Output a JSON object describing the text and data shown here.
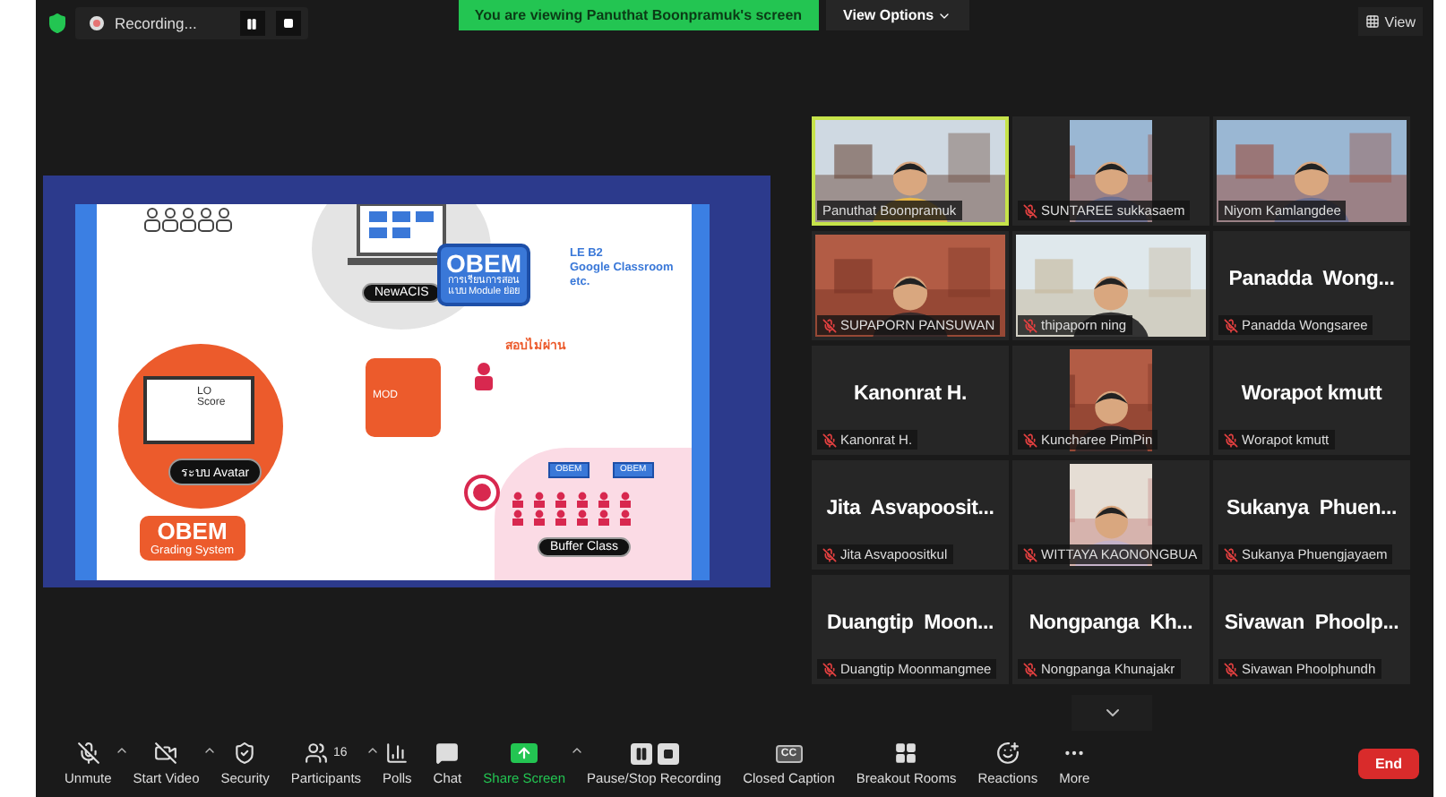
{
  "top_bar": {
    "recording": {
      "label": "Recording..."
    },
    "banner": "You are viewing Panuthat Boonpramuk's screen",
    "view_options": "View Options",
    "view_button": "View"
  },
  "shared_slide": {
    "top_system": "NewACIS",
    "obem": {
      "title": "OBEM",
      "lines": [
        "การเรียนการสอน",
        "แบบ Module ย่อย"
      ]
    },
    "links": [
      "LE B2",
      "Google Classroom",
      "etc."
    ],
    "lo_score": [
      "LO",
      "Score"
    ],
    "avatar": "ระบบ Avatar",
    "grading": {
      "title": "OBEM",
      "subtitle": "Grading System"
    },
    "mod": "MOD",
    "fail_heading": "สอบไม่ผ่าน",
    "buffer": "Buffer Class",
    "buffer_boxes": [
      "OBEM",
      "OBEM"
    ]
  },
  "tiles": [
    {
      "kind": "video",
      "name": "Panuthat Boonpramuk",
      "muted": false,
      "active": true
    },
    {
      "kind": "profile_photo",
      "name": "SUNTAREE sukkasaem",
      "muted": true,
      "active": false
    },
    {
      "kind": "video",
      "name": "Niyom Kamlangdee",
      "muted": false,
      "active": false
    },
    {
      "kind": "video",
      "name": "SUPAPORN PANSUWAN",
      "muted": true,
      "active": false
    },
    {
      "kind": "video",
      "name": "thipaporn ning",
      "muted": true,
      "active": false
    },
    {
      "kind": "name",
      "display": "Panadda  Wong...",
      "name": "Panadda Wongsaree",
      "muted": true,
      "active": false
    },
    {
      "kind": "name",
      "display": "Kanonrat H.",
      "name": "Kanonrat H.",
      "muted": true,
      "active": false
    },
    {
      "kind": "profile_photo",
      "name": "Kuncharee PimPin",
      "muted": true,
      "active": false
    },
    {
      "kind": "name",
      "display": "Worapot kmutt",
      "name": "Worapot kmutt",
      "muted": true,
      "active": false
    },
    {
      "kind": "name",
      "display": "Jita  Asvapoosit...",
      "name": "Jita Asvapoositkul",
      "muted": true,
      "active": false
    },
    {
      "kind": "profile_photo",
      "name": "WITTAYA KAONONGBUA",
      "muted": true,
      "active": false
    },
    {
      "kind": "name",
      "display": "Sukanya  Phuen...",
      "name": "Sukanya Phuengjayaem",
      "muted": true,
      "active": false
    },
    {
      "kind": "name",
      "display": "Duangtip  Moon...",
      "name": "Duangtip Moonmangmee",
      "muted": true,
      "active": false
    },
    {
      "kind": "name",
      "display": "Nongpanga  Kh...",
      "name": "Nongpanga Khunajakr",
      "muted": true,
      "active": false
    },
    {
      "kind": "name",
      "display": "Sivawan  Phoolp...",
      "name": "Sivawan Phoolphundh",
      "muted": true,
      "active": false
    }
  ],
  "toolbar": [
    {
      "kind": "mic_off",
      "label": "Unmute",
      "menu": true
    },
    {
      "kind": "video_off",
      "label": "Start Video",
      "menu": true
    },
    {
      "kind": "security",
      "label": "Security",
      "menu": false
    },
    {
      "kind": "participants",
      "label": "Participants",
      "count": "16",
      "menu": true
    },
    {
      "kind": "polls",
      "label": "Polls",
      "menu": false
    },
    {
      "kind": "chat",
      "label": "Chat",
      "menu": false
    },
    {
      "kind": "share",
      "label": "Share Screen",
      "menu": true
    },
    {
      "kind": "recording",
      "label": "Pause/Stop Recording",
      "menu": false
    },
    {
      "kind": "cc",
      "label": "Closed Caption",
      "icon_text": "CC",
      "menu": false
    },
    {
      "kind": "breakout",
      "label": "Breakout Rooms",
      "menu": false
    },
    {
      "kind": "reactions",
      "label": "Reactions",
      "menu": false
    },
    {
      "kind": "more",
      "label": "More",
      "menu": false
    }
  ],
  "end_button": "End"
}
